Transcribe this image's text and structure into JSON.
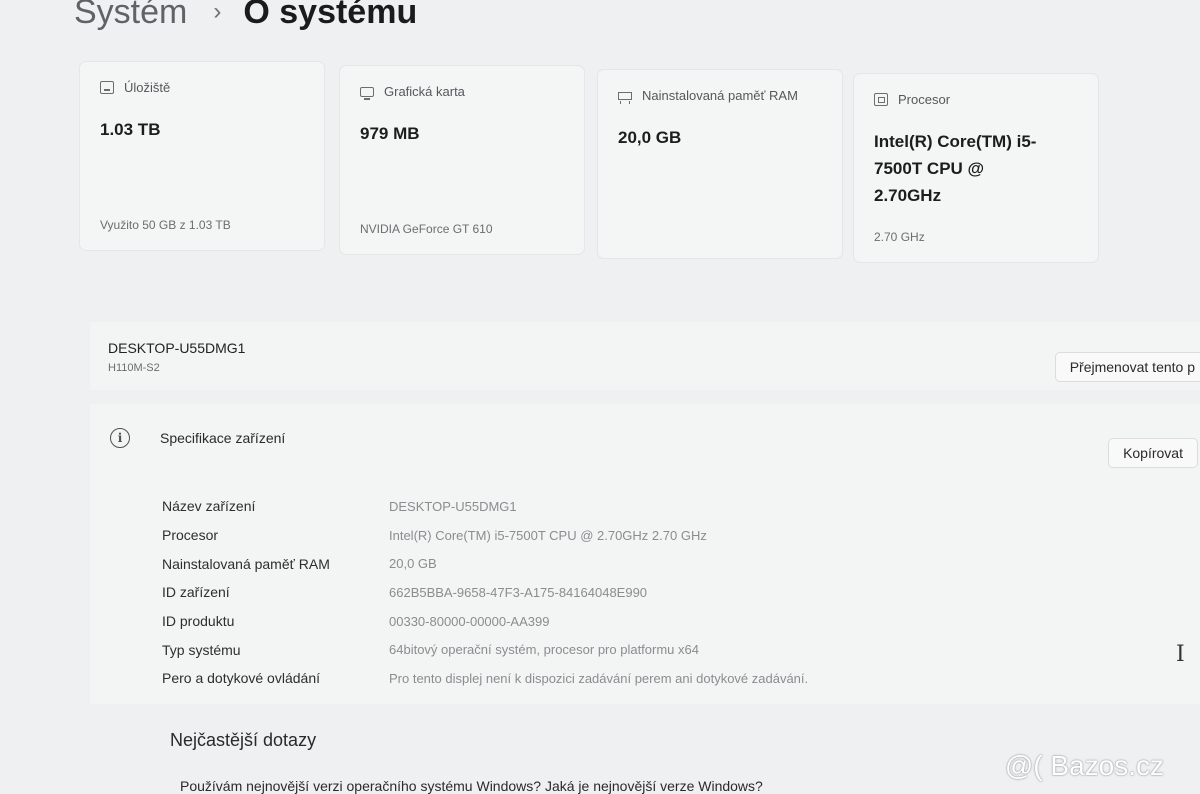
{
  "breadcrumb": {
    "parent": "Systém",
    "separator": "›",
    "current": "O systému"
  },
  "cards": {
    "storage": {
      "title": "Úložiště",
      "value": "1.03 TB",
      "sub": "Využito 50 GB z 1.03 TB"
    },
    "graphics": {
      "title": "Grafická karta",
      "value": "979 MB",
      "sub": "NVIDIA GeForce GT 610"
    },
    "ram": {
      "title": "Nainstalovaná paměť RAM",
      "value": "20,0 GB",
      "sub": ""
    },
    "cpu": {
      "title": "Procesor",
      "value": "Intel(R) Core(TM) i5-7500T CPU @ 2.70GHz",
      "sub": "2.70 GHz"
    }
  },
  "device": {
    "name": "DESKTOP-U55DMG1",
    "model": "H110M-S2",
    "rename_label": "Přejmenovat tento p"
  },
  "spec": {
    "title": "Specifikace zařízení",
    "copy_label": "Kopírovat",
    "rows": [
      {
        "label": "Název zařízení",
        "value": "DESKTOP-U55DMG1"
      },
      {
        "label": "Procesor",
        "value": "Intel(R) Core(TM) i5-7500T CPU @ 2.70GHz   2.70 GHz"
      },
      {
        "label": "Nainstalovaná paměť RAM",
        "value": "20,0 GB"
      },
      {
        "label": "ID zařízení",
        "value": "662B5BBA-9658-47F3-A175-84164048E990"
      },
      {
        "label": "ID produktu",
        "value": "00330-80000-00000-AA399"
      },
      {
        "label": "Typ systému",
        "value": "64bitový operační systém, procesor pro platformu x64"
      },
      {
        "label": "Pero a dotykové ovládání",
        "value": "Pro tento displej není k dispozici zadávání perem ani dotykové zadávání."
      }
    ]
  },
  "faq": {
    "title": "Nejčastější dotazy",
    "question": "Používám nejnovější verzi operačního systému Windows? Jaká je nejnovější verze Windows?"
  },
  "watermark": "@( Bazos.cz",
  "icons": {
    "storage": "storage-icon",
    "graphics": "monitor-icon",
    "ram": "memory-icon",
    "cpu": "processor-icon",
    "info": "info-icon",
    "cursor": "text-cursor-icon"
  }
}
